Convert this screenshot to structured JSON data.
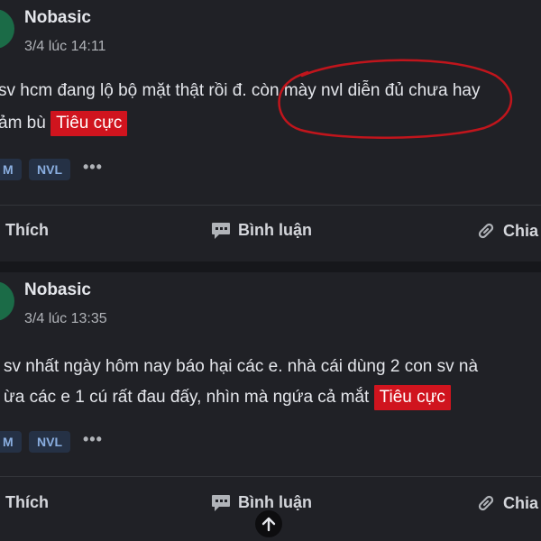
{
  "posts": [
    {
      "author": "Nobasic",
      "time": "3/4 lúc 14:11",
      "lines": [
        "sv hcm đang lộ bộ mặt thật rồi đ. còn mày nvl diễn đủ chưa hay",
        "ảm bù"
      ],
      "badge": "Tiêu cực",
      "tags": [
        "M",
        "NVL"
      ],
      "tag_more": "•••"
    },
    {
      "author": "Nobasic",
      "time": "3/4 lúc 13:35",
      "lines": [
        "sv nhất ngày hôm nay báo hại các e. nhà cái dùng 2 con sv nà",
        "ừa các e 1 cú rất đau đấy, nhìn mà ngứa cả mắt"
      ],
      "badge": "Tiêu cực",
      "tags": [
        "M",
        "NVL"
      ],
      "tag_more": "•••"
    }
  ],
  "actions": {
    "like": "Thích",
    "comment": "Bình luận",
    "share": "Chia"
  },
  "colors": {
    "badge": "#d0141e",
    "annotation": "#c0151c",
    "tag_text": "#8aaee0"
  }
}
